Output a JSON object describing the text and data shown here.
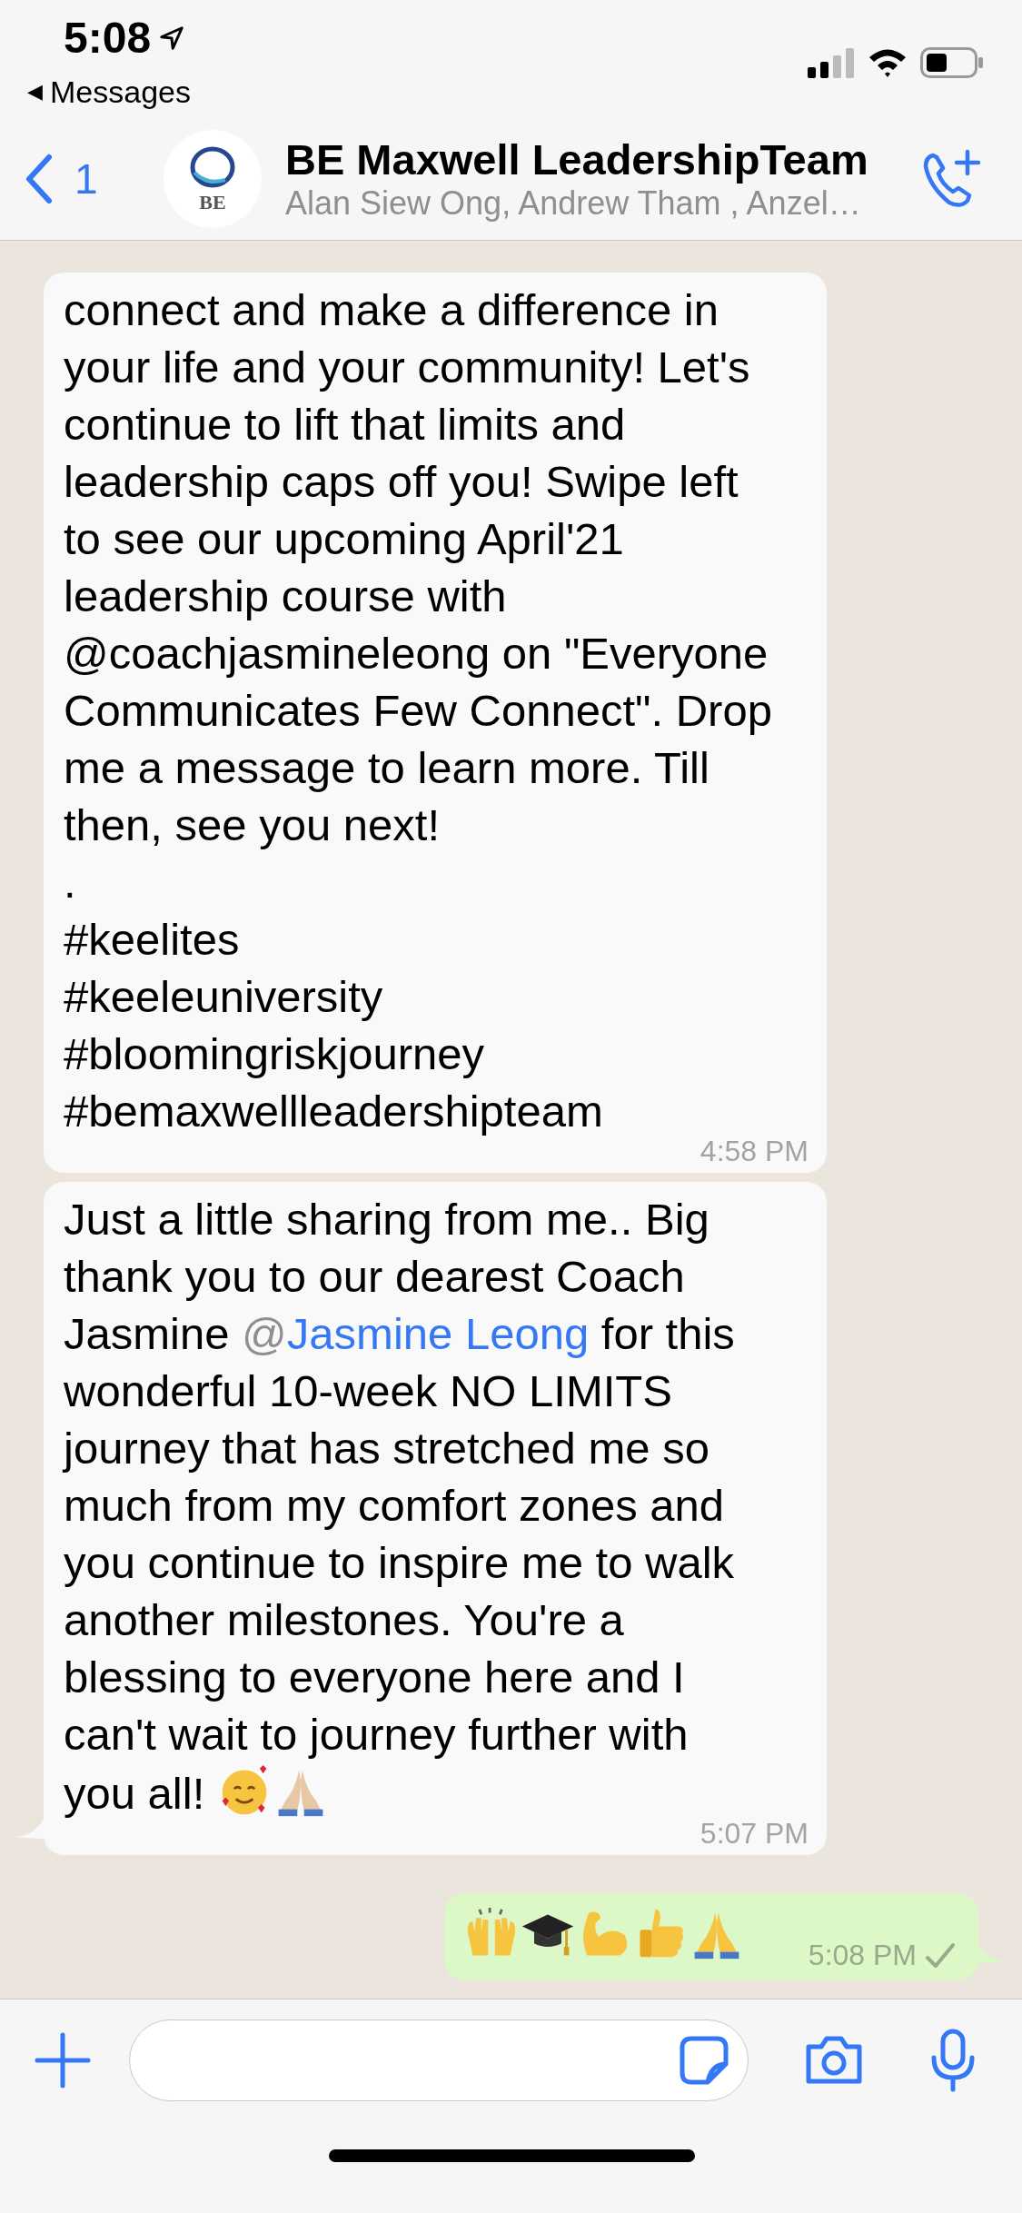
{
  "status_bar": {
    "time": "5:08",
    "back_label": "Messages",
    "back_glyph": "◀"
  },
  "header": {
    "back_count": "1",
    "avatar_text": "BE",
    "title": "BE Maxwell LeadershipTeam",
    "subtitle": "Alan Siew Ong, Andrew Tham , Anzel…"
  },
  "messages": [
    {
      "kind": "incoming",
      "tail": false,
      "parts": [
        {
          "kind": "text",
          "text": "connect and make a difference in\nyour life and your community! Let's\ncontinue to lift that limits and\nleadership caps off you! Swipe left\nto see our upcoming April'21\nleadership course with\n@coachjasmineleong on \"Everyone\nCommunicates Few Connect\". Drop\nme a message to learn more. Till\nthen, see you next!\n.\n#keelites\n#keeleuniversity\n#bloomingriskjourney\n#bemaxwellleadershipteam"
        }
      ],
      "time": "4:58 PM"
    },
    {
      "kind": "incoming",
      "tail": true,
      "parts": [
        {
          "kind": "text",
          "text": "Just a little sharing from me.. Big\nthank you to our dearest Coach\nJasmine "
        },
        {
          "kind": "mention",
          "prefix": "@",
          "text": "Jasmine Leong"
        },
        {
          "kind": "text",
          "text": " for this\nwonderful 10-week NO LIMITS\njourney that has stretched me so\nmuch from my comfort zones and\nyou continue to inspire me to walk\nanother milestones. You're a\nblessing to everyone here and I\ncan't wait to journey further with\nyou all! "
        }
      ],
      "emojis": [
        {
          "kind": "smiling-hearts"
        },
        {
          "kind": "praying-light"
        }
      ],
      "time": "5:07 PM"
    },
    {
      "kind": "outgoing",
      "tail": true,
      "emojis": [
        {
          "kind": "raising-hands"
        },
        {
          "kind": "graduation-cap"
        },
        {
          "kind": "biceps"
        },
        {
          "kind": "thumbs-up"
        },
        {
          "kind": "praying"
        }
      ],
      "time": "5:08 PM",
      "read": false
    }
  ]
}
